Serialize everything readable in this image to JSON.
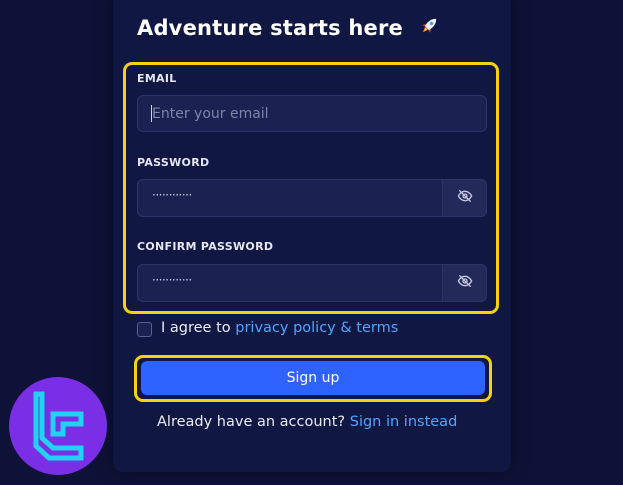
{
  "form": {
    "title": "Adventure starts here",
    "title_icon": "rocket-icon",
    "email": {
      "label": "EMAIL",
      "placeholder": "Enter your email",
      "value": ""
    },
    "password": {
      "label": "PASSWORD",
      "masked_value": "············",
      "toggle_icon": "eye-off-icon"
    },
    "confirm_password": {
      "label": "CONFIRM PASSWORD",
      "masked_value": "············",
      "toggle_icon": "eye-off-icon"
    },
    "agree": {
      "checked": false,
      "prefix": "I agree to ",
      "link": "privacy policy & terms"
    },
    "submit_label": "Sign up",
    "signin": {
      "prefix": "Already have an account? ",
      "link": "Sign in instead"
    }
  },
  "colors": {
    "background": "#0e1238",
    "card": "#111743",
    "accent": "#2f63ff",
    "link": "#4ea5ff",
    "highlight": "#f5d20d",
    "logo_bg": "#7a2ee6",
    "logo_fg": "#21d3f3"
  },
  "watermark_logo": "tc-logo"
}
